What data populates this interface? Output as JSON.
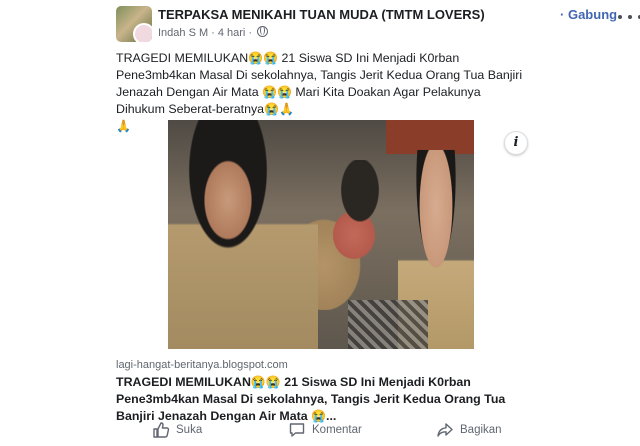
{
  "post": {
    "group_name": "TERPAKSA MENIKAHI TUAN MUDA (TMTM LOVERS)",
    "separator": "·",
    "join_label": "Gabung",
    "author": "Indah S M",
    "dot": "·",
    "time": "4 hari",
    "dot2": "·",
    "text_parts": {
      "p1": "TRAGEDI MEMILUKAN",
      "e1": "😭😭",
      "p2": " 21 Siswa SD Ini Menjadi K0rban Pene3mb4kan Masal Di sekolahnya, Tangis Jerit Kedua Orang Tua Banjiri Jenazah Dengan Air Mata ",
      "e2": "😭😭",
      "p3": " Mari Kita Doakan Agar Pelakunya Dihukum Seberat-beratnya",
      "e3": "😭🙏",
      "e4": "🙏"
    }
  },
  "link_preview": {
    "domain": "lagi-hangat-beritanya.blogspot.com",
    "title_p1": "TRAGEDI MEMILUKAN",
    "title_e1": "😭😭",
    "title_p2": " 21 Siswa SD Ini Menjadi K0rban Pene3mb4kan Masal Di sekolahnya, Tangis Jerit Kedua Orang Tua Banjiri Jenazah Dengan Air Mata ",
    "title_e2": "😭",
    "title_p3": "...",
    "info_glyph": "i"
  },
  "actions": {
    "like": "Suka",
    "comment": "Komentar",
    "share": "Bagikan"
  },
  "colors": {
    "link_blue": "#4267b2",
    "meta_grey": "#606770",
    "text": "#1c1e21"
  },
  "icons": [
    "group-avatar",
    "globe-icon",
    "more-options-icon",
    "info-icon",
    "like-icon",
    "comment-icon",
    "share-icon"
  ]
}
